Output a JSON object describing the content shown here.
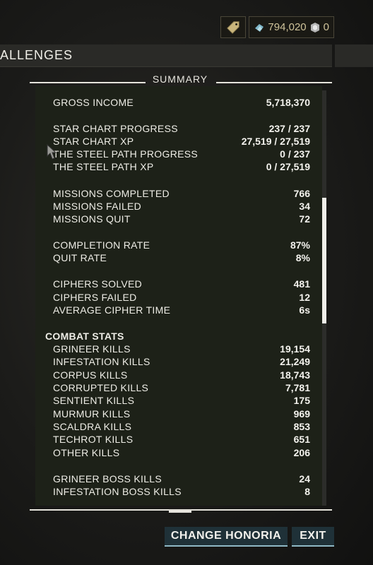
{
  "currency": {
    "platinum": "794,020",
    "credits_extra": "0",
    "icons": [
      "price-tag-icon",
      "platinum-icon",
      "credits-icon"
    ]
  },
  "header": {
    "title": "ALLENGES"
  },
  "summary": {
    "label": "SUMMARY",
    "cut_top_value": "",
    "rows": [
      {
        "label": "GROSS INCOME",
        "value": "5,718,370"
      },
      {
        "label": "STAR CHART PROGRESS",
        "value": "237 / 237"
      },
      {
        "label": "STAR CHART XP",
        "value": "27,519 / 27,519"
      },
      {
        "label": "THE STEEL PATH PROGRESS",
        "value": "0 / 237"
      },
      {
        "label": "THE STEEL PATH XP",
        "value": "0 / 27,519"
      },
      {
        "label": "MISSIONS COMPLETED",
        "value": "766"
      },
      {
        "label": "MISSIONS FAILED",
        "value": "34"
      },
      {
        "label": "MISSIONS QUIT",
        "value": "72"
      },
      {
        "label": "COMPLETION RATE",
        "value": "87%"
      },
      {
        "label": "QUIT RATE",
        "value": "8%"
      },
      {
        "label": "CIPHERS SOLVED",
        "value": "481"
      },
      {
        "label": "CIPHERS FAILED",
        "value": "12"
      },
      {
        "label": "AVERAGE CIPHER TIME",
        "value": "6s"
      },
      {
        "label": "COMBAT STATS",
        "value": "",
        "section": true
      },
      {
        "label": "GRINEER KILLS",
        "value": "19,154"
      },
      {
        "label": "INFESTATION KILLS",
        "value": "21,249"
      },
      {
        "label": "CORPUS KILLS",
        "value": "18,743"
      },
      {
        "label": "CORRUPTED KILLS",
        "value": "7,781"
      },
      {
        "label": "SENTIENT KILLS",
        "value": "175"
      },
      {
        "label": "MURMUR KILLS",
        "value": "969"
      },
      {
        "label": "SCALDRA KILLS",
        "value": "853"
      },
      {
        "label": "TECHROT KILLS",
        "value": "651"
      },
      {
        "label": "OTHER KILLS",
        "value": "206"
      },
      {
        "label": "GRINEER BOSS KILLS",
        "value": "24"
      },
      {
        "label": "INFESTATION BOSS KILLS",
        "value": "8"
      }
    ]
  },
  "buttons": {
    "change_honoria": "CHANGE HONORIA",
    "exit": "EXIT"
  },
  "colors": {
    "panel_bg": "#1d2118",
    "button_bg": "#1f3138",
    "button_accent": "#8fb8c5",
    "currency_text": "#cfc39a"
  }
}
